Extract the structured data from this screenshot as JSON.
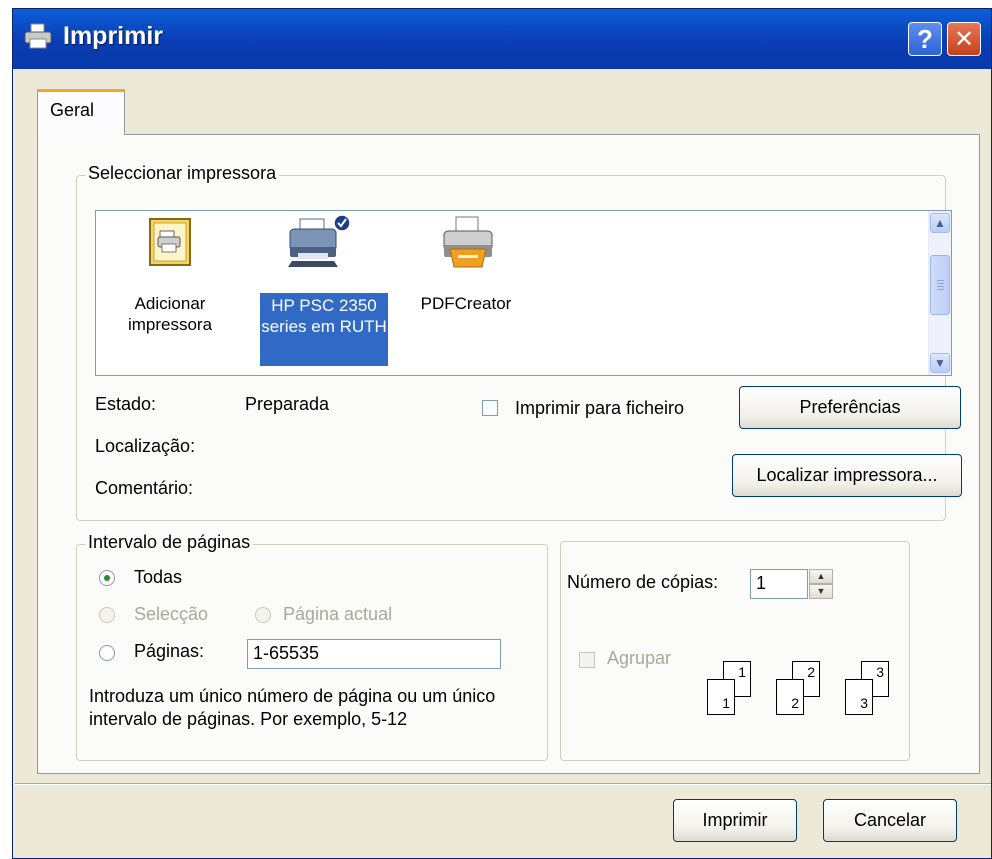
{
  "window": {
    "title": "Imprimir",
    "help_glyph": "?",
    "close_glyph": "✕"
  },
  "tabs": [
    {
      "label": "Geral"
    }
  ],
  "select_printer": {
    "legend": "Seleccionar impressora",
    "printers": [
      {
        "label": "Adicionar impressora",
        "icon": "add-printer-icon",
        "selected": false
      },
      {
        "label": "HP PSC 2350 series em RUTH",
        "icon": "network-printer-icon",
        "selected": true
      },
      {
        "label": "PDFCreator",
        "icon": "printer-icon",
        "selected": false
      }
    ],
    "status_label": "Estado:",
    "status_value": "Preparada",
    "location_label": "Localização:",
    "comment_label": "Comentário:",
    "print_to_file_label": "Imprimir para ficheiro",
    "preferences_button": "Preferências",
    "find_printer_button": "Localizar impressora..."
  },
  "page_range": {
    "legend": "Intervalo de páginas",
    "all_label": "Todas",
    "selection_label": "Selecção",
    "current_page_label": "Página actual",
    "pages_label": "Páginas:",
    "pages_value": "1-65535",
    "hint": "Introduza um único número de página ou um único intervalo de páginas. Por exemplo, 5-12"
  },
  "copies": {
    "label": "Número de cópias:",
    "value": "1",
    "collate_label": "Agrupar",
    "collate_pages": [
      "1",
      "1",
      "2",
      "2",
      "3",
      "3"
    ]
  },
  "buttons": {
    "print": "Imprimir",
    "cancel": "Cancelar"
  }
}
